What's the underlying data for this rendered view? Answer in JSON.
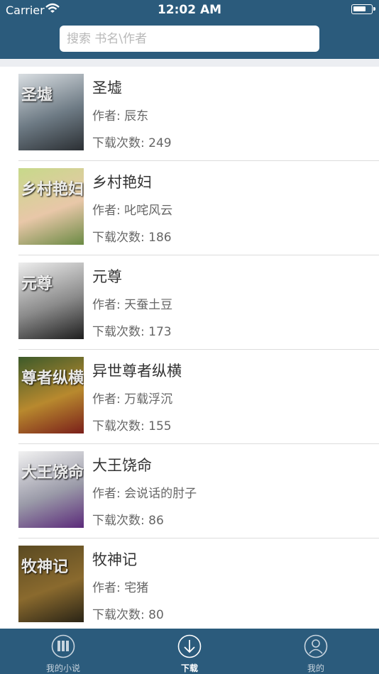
{
  "status_bar": {
    "carrier": "Carrier",
    "time": "12:02 AM"
  },
  "search": {
    "placeholder": "搜索 书名\\作者"
  },
  "books": [
    {
      "title": "圣墟",
      "author": "作者: 辰东",
      "downloads": "下载次数: 249",
      "cover_text": "圣墟",
      "cover_colors": [
        "#d9dee2",
        "#6d7a84",
        "#2b2f33"
      ]
    },
    {
      "title": "乡村艳妇",
      "author": "作者: 叱咤风云",
      "downloads": "下载次数: 186",
      "cover_text": "乡村艳妇",
      "cover_colors": [
        "#c7d98a",
        "#e8c7a8",
        "#6b8a44"
      ]
    },
    {
      "title": "元尊",
      "author": "作者: 天蚕土豆",
      "downloads": "下载次数: 173",
      "cover_text": "元尊",
      "cover_colors": [
        "#eeeeee",
        "#8b8b8b",
        "#1e1e1e"
      ]
    },
    {
      "title": "异世尊者纵横",
      "author": "作者: 万载浮沉",
      "downloads": "下载次数: 155",
      "cover_text": "尊者纵横",
      "cover_colors": [
        "#3c5a2a",
        "#b8892e",
        "#7a1f1a"
      ]
    },
    {
      "title": "大王饶命",
      "author": "作者: 会说话的肘子",
      "downloads": "下载次数: 86",
      "cover_text": "大王饶命",
      "cover_colors": [
        "#f2f2f2",
        "#9a9aa8",
        "#5b2a7a"
      ]
    },
    {
      "title": "牧神记",
      "author": "作者: 宅猪",
      "downloads": "下载次数: 80",
      "cover_text": "牧神记",
      "cover_colors": [
        "#5a4a22",
        "#8a6a2e",
        "#2a2416"
      ]
    }
  ],
  "tabs": [
    {
      "label": "我的小说",
      "icon": "books-icon",
      "active": false
    },
    {
      "label": "下载",
      "icon": "download-icon",
      "active": true
    },
    {
      "label": "我的",
      "icon": "user-icon",
      "active": false
    }
  ],
  "colors": {
    "header": "#2b5b7c",
    "tabbar": "#2b5b7c",
    "separator": "#dcdcdc"
  }
}
